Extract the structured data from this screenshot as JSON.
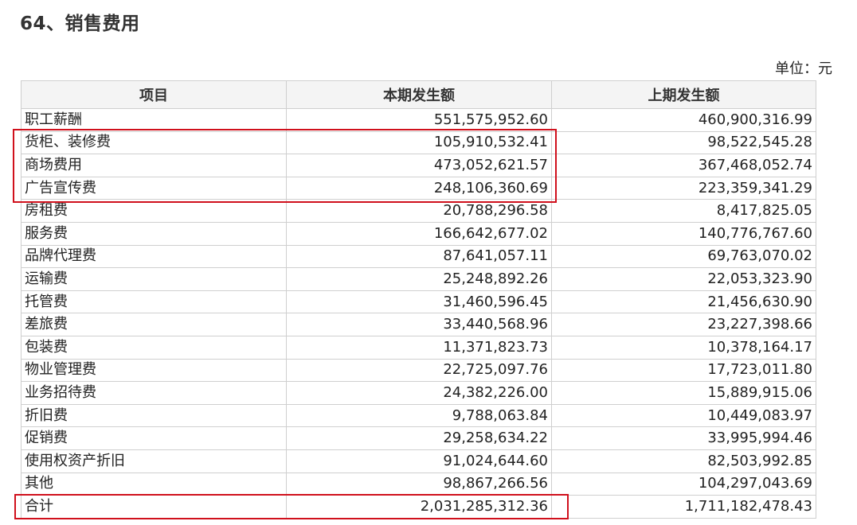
{
  "title": "64、销售费用",
  "unit": "单位：元",
  "table": {
    "headers": [
      "项目",
      "本期发生额",
      "上期发生额"
    ],
    "rows": [
      [
        "职工薪酬",
        "551,575,952.60",
        "460,900,316.99"
      ],
      [
        "货柜、装修费",
        "105,910,532.41",
        "98,522,545.28"
      ],
      [
        "商场费用",
        "473,052,621.57",
        "367,468,052.74"
      ],
      [
        "广告宣传费",
        "248,106,360.69",
        "223,359,341.29"
      ],
      [
        "房租费",
        "20,788,296.58",
        "8,417,825.05"
      ],
      [
        "服务费",
        "166,642,677.02",
        "140,776,767.60"
      ],
      [
        "品牌代理费",
        "87,641,057.11",
        "69,763,070.02"
      ],
      [
        "运输费",
        "25,248,892.26",
        "22,053,323.90"
      ],
      [
        "托管费",
        "31,460,596.45",
        "21,456,630.90"
      ],
      [
        "差旅费",
        "33,440,568.96",
        "23,227,398.66"
      ],
      [
        "包装费",
        "11,371,823.73",
        "10,378,164.17"
      ],
      [
        "物业管理费",
        "22,725,097.76",
        "17,723,011.80"
      ],
      [
        "业务招待费",
        "24,382,226.00",
        "15,889,915.06"
      ],
      [
        "折旧费",
        "9,788,063.84",
        "10,449,083.97"
      ],
      [
        "促销费",
        "29,258,634.22",
        "33,995,994.46"
      ],
      [
        "使用权资产折旧",
        "91,024,644.60",
        "82,503,992.85"
      ],
      [
        "其他",
        "98,867,266.56",
        "104,297,043.69"
      ],
      [
        "合计",
        "2,031,285,312.36",
        "1,711,182,478.43"
      ]
    ]
  },
  "highlight_color": "#d0101c"
}
